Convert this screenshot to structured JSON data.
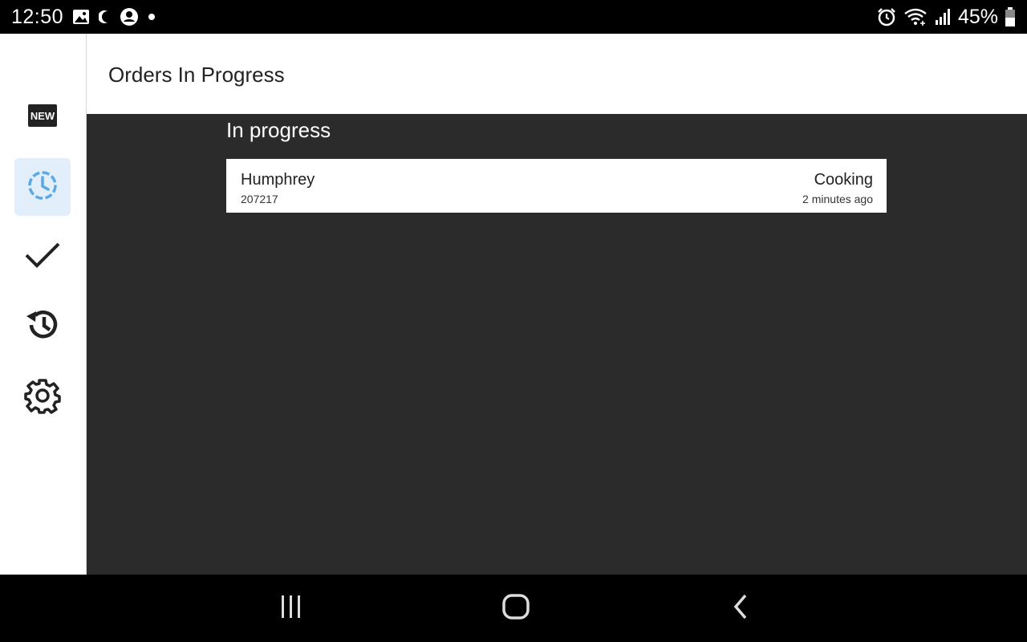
{
  "status_bar": {
    "time": "12:50",
    "battery": "45%",
    "left_icons": [
      "image-icon",
      "moon-icon",
      "account-icon",
      "dot-icon"
    ],
    "right_icons": [
      "alarm-icon",
      "wifi-icon",
      "signal-icon",
      "battery-icon"
    ]
  },
  "sidebar": {
    "items": [
      {
        "name": "new-orders",
        "icon": "new-icon",
        "active": false
      },
      {
        "name": "in-progress",
        "icon": "clock-icon",
        "active": true
      },
      {
        "name": "completed",
        "icon": "check-icon",
        "active": false
      },
      {
        "name": "history",
        "icon": "history-icon",
        "active": false
      },
      {
        "name": "settings",
        "icon": "gear-icon",
        "active": false
      }
    ]
  },
  "header": {
    "title": "Orders In Progress"
  },
  "main": {
    "section_title": "In progress",
    "orders": [
      {
        "customer": "Humphrey",
        "number": "207217",
        "status": "Cooking",
        "time_ago": "2 minutes ago"
      }
    ]
  },
  "colors": {
    "active_accent": "#5aa9e6",
    "active_bg": "#e3eefb",
    "content_bg": "#2b2b2b"
  },
  "navigation_bar": {
    "buttons": [
      "recents-icon",
      "home-icon",
      "back-icon"
    ]
  }
}
